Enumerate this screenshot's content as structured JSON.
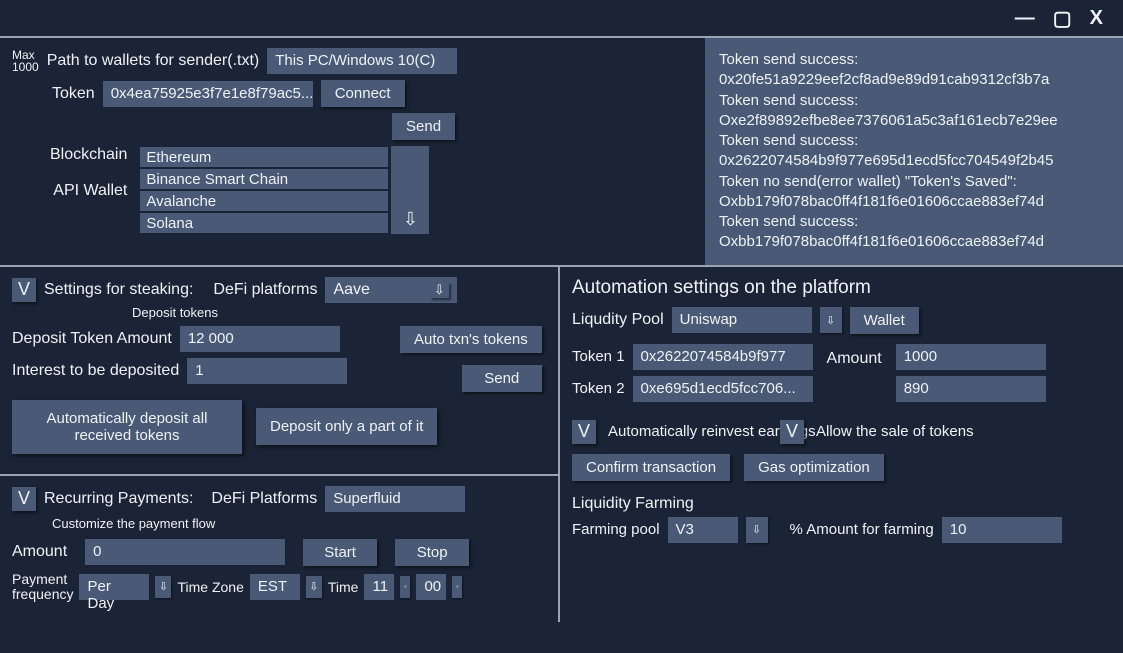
{
  "titlebar": {
    "min": "—",
    "max": "▢",
    "close": "X"
  },
  "sender": {
    "max_label": "Max\n1000",
    "path_label": "Path to wallets for sender(.txt)",
    "path_value": "This PC/Windows 10(C)",
    "token_label": "Token",
    "token_value": "0x4ea75925e3f7e1e8f79ac5...",
    "connect": "Connect",
    "send": "Send",
    "blockchain_label": "Blockchain",
    "api_wallet_label": "API Wallet",
    "chains": [
      "Ethereum",
      "Binance Smart Chain",
      "Avalanche",
      "Solana"
    ]
  },
  "log": [
    "Token send success:",
    "0x20fe51a9229eef2cf8ad9e89d91cab9312cf3b7a",
    "Token send success:",
    "Oxe2f89892efbe8ee7376061a5c3af161ecb7e29ee",
    "Token send success:",
    "0x2622074584b9f977e695d1ecd5fcc704549f2b45",
    "Token no send(error wallet) \"Token's Saved\":",
    "Oxbb179f078bac0ff4f181f6e01606ccae883ef74d",
    "Token send success:",
    "Oxbb179f078bac0ff4f181f6e01606ccae883ef74d"
  ],
  "staking": {
    "title": "Settings for steaking:",
    "defi_label": "DeFi platforms",
    "defi_value": "Aave",
    "deposit_tokens": "Deposit tokens",
    "amount_label": "Deposit Token Amount",
    "amount_value": "12 000",
    "interest_label": "Interest to be deposited",
    "interest_value": "1",
    "auto_txn": "Auto txn's tokens",
    "send": "Send",
    "deposit_all": "Automatically deposit all received tokens",
    "deposit_part": "Deposit only a part of it"
  },
  "recurring": {
    "title": "Recurring Payments:",
    "defi_label": "DeFi Platforms",
    "defi_value": "Superfluid",
    "customize": "Customize the payment flow",
    "amount_label": "Amount",
    "amount_value": "0",
    "start": "Start",
    "stop": "Stop",
    "freq_label": "Payment\nfrequency",
    "freq_value": "Per Day",
    "tz_label": "Time Zone",
    "tz_value": "EST",
    "time_label": "Time",
    "time_h": "11",
    "time_m": "00"
  },
  "automation": {
    "title": "Automation settings on the platform",
    "pool_label": "Liqudity Pool",
    "pool_value": "Uniswap",
    "wallet": "Wallet",
    "token1_label": "Token 1",
    "token1_value": "0x2622074584b9f977",
    "token2_label": "Token 2",
    "token2_value": "0xe695d1ecd5fcc706...",
    "amount_label": "Amount",
    "amount1": "1000",
    "amount2": "890",
    "reinvest": "Automatically reinvest earnings",
    "allow_sale": "Allow the sale of tokens",
    "confirm": "Confirm transaction",
    "gas": "Gas optimization",
    "farming_title": "Liquidity Farming",
    "farming_pool_label": "Farming pool",
    "farming_pool_value": "V3",
    "pct_label": "% Amount for farming",
    "pct_value": "10"
  }
}
